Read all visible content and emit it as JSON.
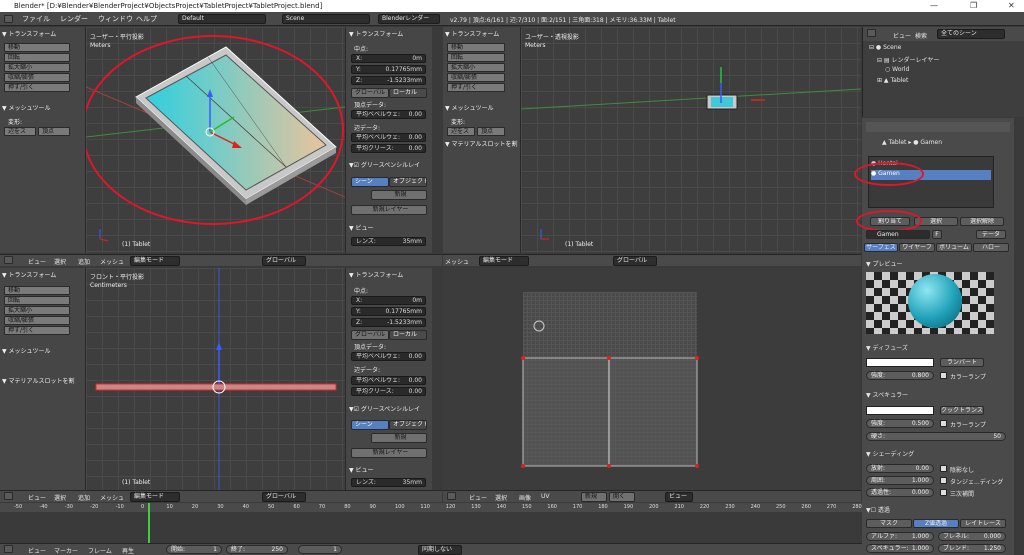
{
  "title": "Blender* [D:¥Blender¥BlenderProject¥ObjectsProject¥TabletProject¥TabletProject.blend]",
  "menu": {
    "items": [
      "ファイル",
      "レンダー",
      "ウィンドウ",
      "ヘルプ"
    ],
    "layout": "Default",
    "scene": "Scene",
    "engine": "Blenderレンダー",
    "stats": "v2.79 | 頂点:6/161 | 辺:7/310 | 面:2/151 | 三角面:318 | メモリ:36.33M | Tablet"
  },
  "toolshelf": {
    "transform": "トランスフォーム",
    "translate": "移動",
    "rotate": "回転",
    "scale": "拡大縮小",
    "shrink": "収縮/膨張",
    "push": "押す/引く",
    "meshtools": "メッシュツール",
    "deform": "変形:",
    "slide_edge": "辺をス",
    "vertex": "頂点",
    "material_slot": "マテリアルスロットを割"
  },
  "viewports": {
    "tl": {
      "name": "ユーザー・平行投影",
      "units": "Meters",
      "object": "(1) Tablet"
    },
    "tr": {
      "name": "ユーザー・透視投影",
      "units": "Meters",
      "object": "(1) Tablet",
      "material_slot": "マテリアルスロットを割"
    },
    "bl": {
      "name": "フロント・平行投影",
      "units": "Centimeters",
      "object": "(1) Tablet"
    }
  },
  "npanel": {
    "transform": "トランスフォーム",
    "median": "中点:",
    "x_label": "X:",
    "x_val": "0m",
    "y_label": "Y:",
    "y_val": "0.17765mm",
    "z_label": "Z:",
    "z_val": "-1.5233mm",
    "global": "グローバル",
    "local": "ローカル",
    "vertex_data": "頂点データ:",
    "mean_bevel": "平均ベベルウェ:",
    "mean_bevel_val": "0.00",
    "edge_data": "辺データ:",
    "mean_bevel2": "平均ベベルウェ:",
    "mean_bevel2_val": "0.00",
    "mean_crease": "平均クリース:",
    "mean_crease_val": "0.00",
    "gpencil": "グリースペンシルレイ",
    "scene": "シーン",
    "object": "オブジェクト",
    "new": "新規",
    "new_layer": "新規レイヤー",
    "view": "ビュー",
    "lens": "レンズ:",
    "lens_val": "35mm"
  },
  "headers": {
    "view": "ビュー",
    "select": "選択",
    "add": "追加",
    "mesh": "メッシュ",
    "editmode": "編集モード",
    "global": "グローバル",
    "image": "画像",
    "uv": "UV",
    "new": "新規",
    "open": "開く",
    "view_short": "ビュー"
  },
  "outliner": {
    "view": "ビュー",
    "search": "検索",
    "all_scenes": "全てのシーン",
    "scene": "Scene",
    "render_layers": "レンダーレイヤー",
    "world": "World",
    "tablet": "Tablet"
  },
  "properties": {
    "crumb_tablet": "Tablet",
    "crumb_gamen": "Gamen",
    "slot1": "Hontai",
    "slot2": "Gamen",
    "assign": "割り当て",
    "select": "選択",
    "deselect": "選択解除",
    "matname": "Gamen",
    "users": "F",
    "data": "データ",
    "tab_surface": "サーフェス",
    "tab_wire": "ワイヤーフ",
    "tab_volume": "ボリューム",
    "tab_halo": "ハロー",
    "preview": "プレビュー",
    "diffuse": "ディフューズ",
    "lambert": "ランバート",
    "intensity": "強度:",
    "diff_int": "0.800",
    "ramp": "カラーランプ",
    "specular": "スペキュラー",
    "cooktorr": "クックトランス",
    "spec_int": "0.500",
    "hardness": "硬さ:",
    "hardness_val": "50",
    "shading": "シェーディング",
    "emit": "放射:",
    "emit_val": "0.00",
    "shadeless": "陰影なし",
    "ambient": "周囲:",
    "ambient_val": "1.000",
    "tangent": "タンジェ...ディング",
    "translucency": "透過性:",
    "transl_val": "0.000",
    "cubic": "三次補間",
    "transparency": "透過",
    "mask": "マスク",
    "ztransp": "Z値透過",
    "raytrace": "レイトレース",
    "alpha": "アルファ:",
    "alpha_val": "1.000",
    "fresnel": "フレネル:",
    "fresnel_val": "0.000",
    "spec_alpha": "スペキュラー:",
    "spec_alpha_val": "1.000",
    "blend": "ブレンド:",
    "blend_val": "1.250"
  },
  "timeline": {
    "ticks": [
      "-50",
      "-40",
      "-30",
      "-20",
      "-10",
      "0",
      "10",
      "20",
      "30",
      "40",
      "50",
      "60",
      "70",
      "80",
      "90",
      "100",
      "110",
      "120",
      "130",
      "140",
      "150",
      "160",
      "170",
      "180",
      "190",
      "200",
      "210",
      "220",
      "230",
      "240",
      "250",
      "260",
      "270",
      "280"
    ],
    "view": "ビュー",
    "marker": "マーカー",
    "frame": "フレーム",
    "play": "再生",
    "start_label": "開始:",
    "start_val": "1",
    "end_label": "終了:",
    "end_val": "250",
    "current": "1",
    "sync": "同期しない"
  }
}
